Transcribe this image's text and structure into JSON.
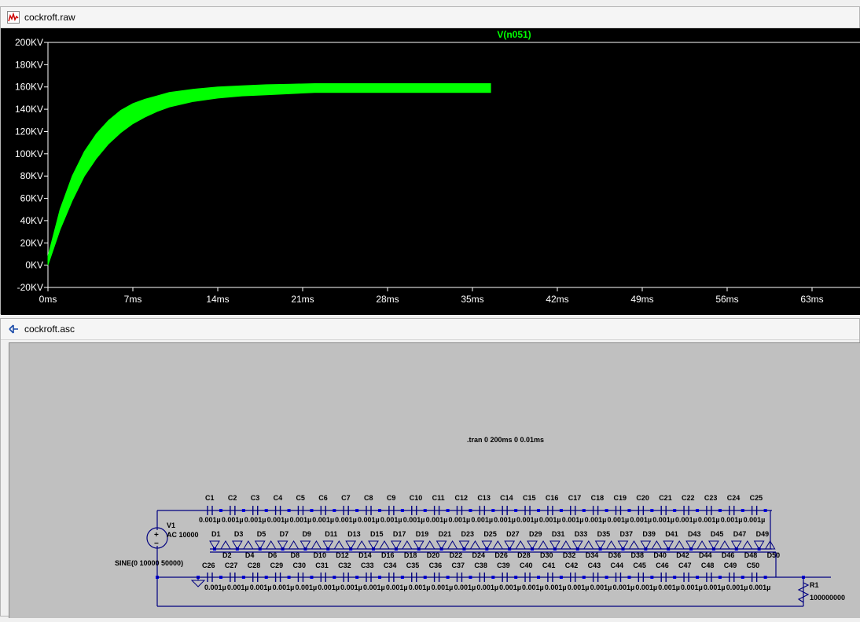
{
  "plot_window": {
    "title": "cockroft.raw",
    "icon": "waveform-icon"
  },
  "schematic_window": {
    "title": "cockroft.asc",
    "icon": "schematic-icon",
    "directive": ".tran 0 200ms 0 0.01ms",
    "source": {
      "name": "V1",
      "value": "AC 10000",
      "function": "SINE(0 10000 50000)"
    },
    "resistor": {
      "name": "R1",
      "value": "100000000"
    },
    "cap_value": "0.001µ"
  },
  "chart_data": {
    "type": "area",
    "series": [
      {
        "name": "V(n051)",
        "color": "#00ff00"
      }
    ],
    "x_ticks": [
      "0ms",
      "7ms",
      "14ms",
      "21ms",
      "28ms",
      "35ms",
      "42ms",
      "49ms",
      "56ms",
      "63ms"
    ],
    "y_ticks": [
      "200KV",
      "180KV",
      "160KV",
      "140KV",
      "120KV",
      "100KV",
      "80KV",
      "60KV",
      "40KV",
      "20KV",
      "0KV",
      "-20KV"
    ],
    "xlim": [
      0,
      63
    ],
    "ylim": [
      -20,
      200
    ],
    "x_unit": "ms",
    "y_unit": "KV",
    "x": [
      0,
      1,
      2,
      3,
      4,
      5,
      6,
      7,
      8,
      9,
      10,
      12,
      14,
      16,
      18,
      20,
      22,
      25,
      28,
      31,
      34,
      36.5
    ],
    "upper": [
      8,
      50,
      80,
      102,
      118,
      130,
      139,
      145,
      149,
      152,
      155,
      158,
      160,
      161,
      162,
      162.5,
      163,
      163,
      163,
      163,
      163,
      163
    ],
    "lower": [
      0,
      32,
      58,
      80,
      96,
      109,
      119,
      127,
      133,
      138,
      142,
      147,
      150,
      152,
      153,
      154,
      155,
      155,
      155,
      155,
      155,
      155
    ],
    "background": "#000000",
    "axis_color": "#ffffff"
  }
}
